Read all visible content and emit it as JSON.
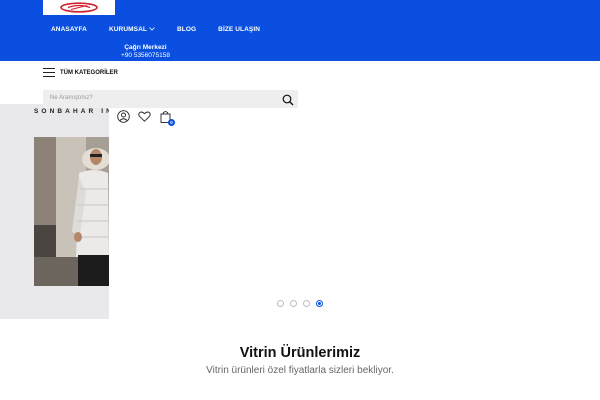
{
  "header": {
    "logo_alt": "R",
    "nav": [
      {
        "label": "ANASAYFA",
        "has_dropdown": false
      },
      {
        "label": "KURUMSAL",
        "has_dropdown": true
      },
      {
        "label": "BLOG",
        "has_dropdown": false
      },
      {
        "label": "BİZE ULAŞIN",
        "has_dropdown": false
      }
    ],
    "call_center": {
      "title": "Çağrı Merkezi",
      "phone": "+90 5356075158"
    },
    "brand_color": "#0a4fe0"
  },
  "categories": {
    "label": "TÜM KATEGORİLER",
    "icon": "hamburger-icon"
  },
  "search": {
    "placeholder": "Ne Aramıştınız?",
    "icon": "search-icon"
  },
  "user_actions": {
    "account_icon": "user-icon",
    "wishlist_icon": "heart-icon",
    "cart_icon": "bag-icon",
    "cart_count": "0"
  },
  "hero": {
    "title": "SONBAHAR İN",
    "slides": 4,
    "active_slide": 4
  },
  "showcase": {
    "title": "Vitrin Ürünlerimiz",
    "subtitle": "Vitrin ürünleri özel fiyatlarla sizleri bekliyor."
  }
}
